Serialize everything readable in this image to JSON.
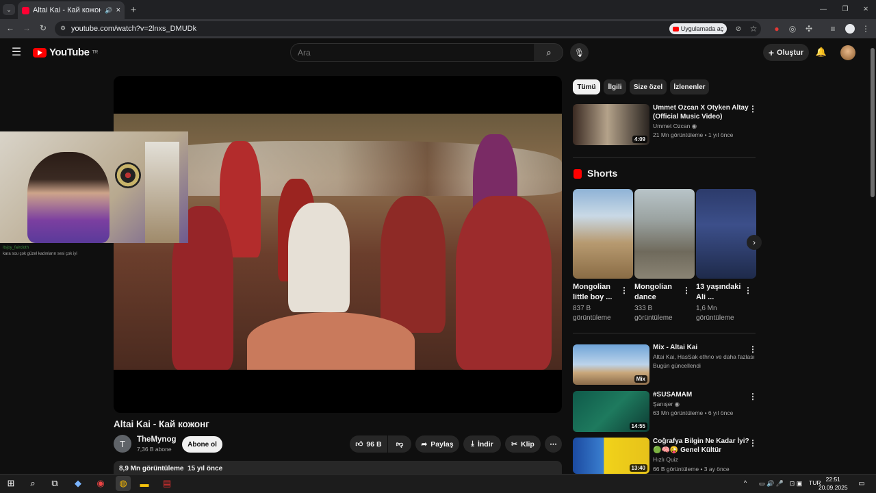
{
  "browser": {
    "tab_title": "Altai Kai - Кай кожонг - Yo",
    "url": "youtube.com/watch?v=2lnxs_DMUDk",
    "open_in_app": "Uygulamada aç"
  },
  "header": {
    "logo": "YouTube",
    "region": "TR",
    "search_placeholder": "Ara",
    "create_label": "Oluştur"
  },
  "video": {
    "title": "Altai Kai - Кай кожонг",
    "channel_initial": "T",
    "channel_name": "TheMynog",
    "subscribers": "7,36 B abone",
    "subscribe_label": "Abone ol",
    "likes": "96 B",
    "share_label": "Paylaş",
    "download_label": "İndir",
    "clip_label": "Klip",
    "views": "8,9 Mn görüntüleme",
    "age": "15 yıl önce"
  },
  "overlay": {
    "chat_user": "itsjoy_faircloth",
    "chat_text": "kara sou çok güzel kadınların sesi çok iyi"
  },
  "chips": [
    {
      "label": "Tümü",
      "active": true
    },
    {
      "label": "İlgili"
    },
    {
      "label": "Size özel"
    },
    {
      "label": "İzlenenler"
    }
  ],
  "related": [
    {
      "title": "Ummet Ozcan X Otyken   Altay (Official Music Video)",
      "channel": "Ummet Ozcan",
      "meta": "21 Mn görüntüleme • 1 yıl önce",
      "duration": "4:09"
    },
    {
      "title": "Mix - Altai Kai",
      "channel": "Altai Kai, HasSak ethno ve daha fazlası",
      "meta": "Bugün güncellendi",
      "duration": "Mix"
    },
    {
      "title": "#SUSAMAM",
      "channel": "Şanışer",
      "meta": "63 Mn görüntüleme • 6 yıl önce",
      "duration": "14:55"
    },
    {
      "title": "Coğrafya Bilgin Ne Kadar İyi? 🟢🧠😜 Genel Kültür",
      "channel": "Hızlı Quiz",
      "meta": "66 B görüntüleme • 3 ay önce",
      "duration": "13:40"
    }
  ],
  "shorts": {
    "heading": "Shorts",
    "items": [
      {
        "title": "Mongolian little boy ...",
        "views": "837 B görüntüleme"
      },
      {
        "title": "Mongolian dance",
        "views": "333 B görüntüleme"
      },
      {
        "title": "13 yaşındaki Ali ...",
        "views": "1,6 Mn görüntüleme"
      }
    ]
  },
  "taskbar": {
    "lang": "TUR",
    "time": "22:51",
    "date": "20.09.2025"
  },
  "colors": {
    "accent": "#ff0000",
    "background": "#0f0f0f",
    "chip": "#272727"
  }
}
